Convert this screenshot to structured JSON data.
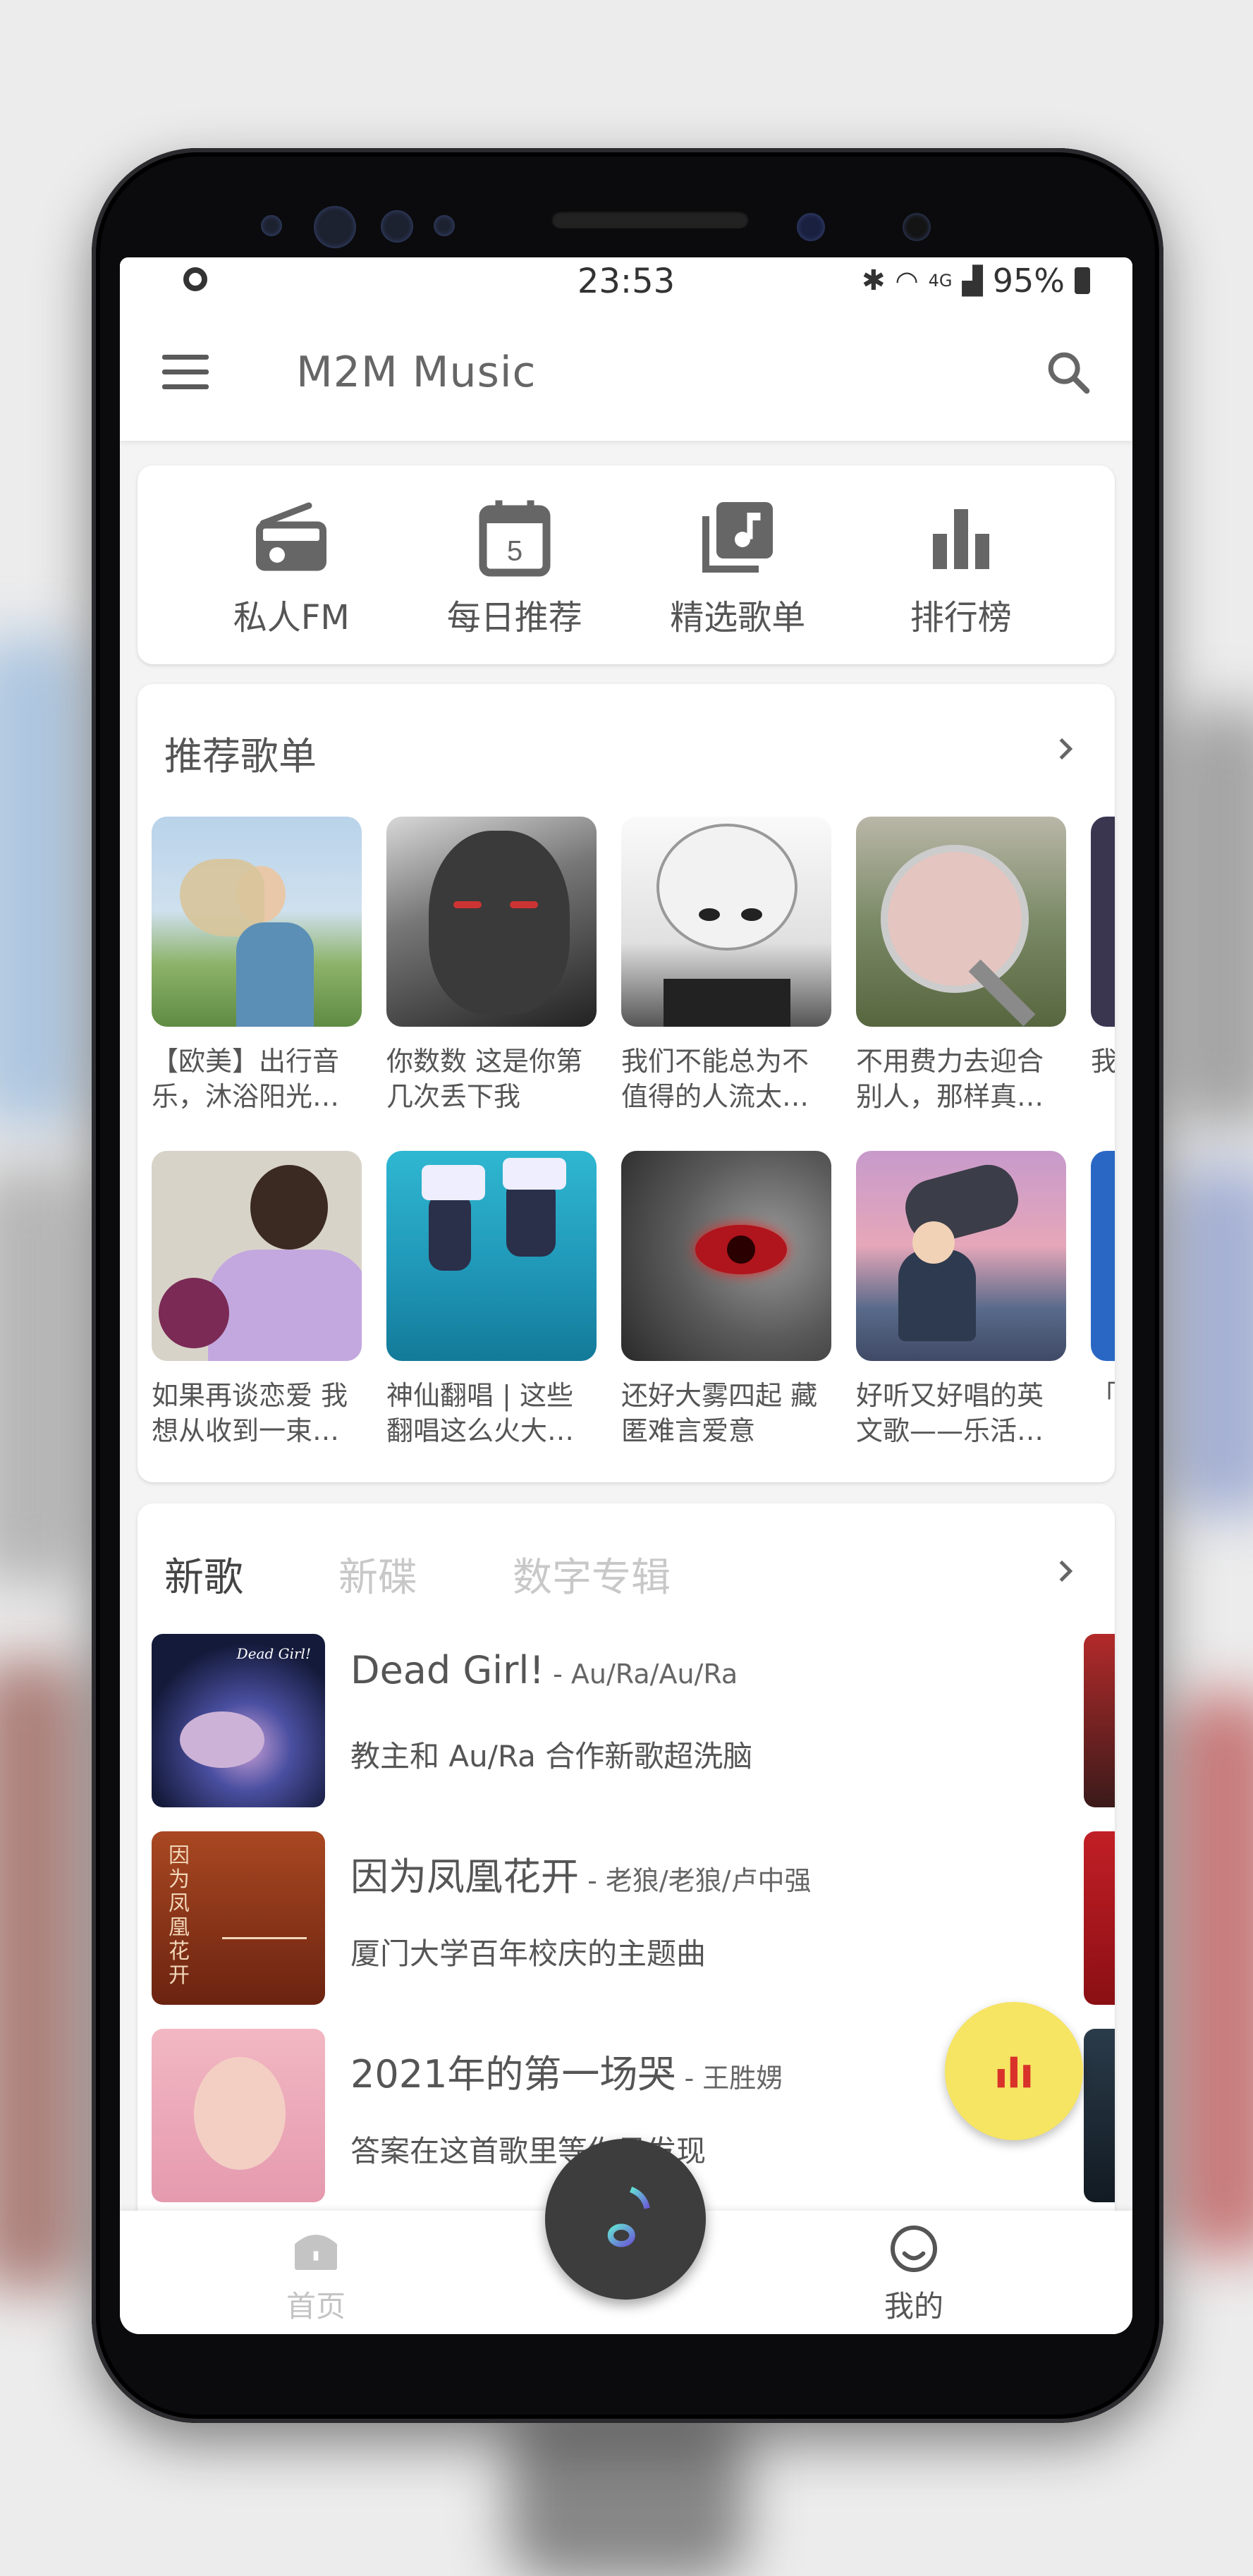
{
  "status_bar": {
    "time": "23:53",
    "signal_label": "4G",
    "battery": "95%"
  },
  "app_bar": {
    "title": "M2M Music"
  },
  "shortcuts": [
    {
      "label": "私人FM",
      "icon": "radio-icon"
    },
    {
      "label": "每日推荐",
      "icon": "calendar-icon",
      "day": "5"
    },
    {
      "label": "精选歌单",
      "icon": "music-library-icon"
    },
    {
      "label": "排行榜",
      "icon": "bar-chart-icon"
    }
  ],
  "recommended": {
    "title": "推荐歌单",
    "row1": [
      {
        "caption": "【欧美】出行音乐，沐浴阳光…"
      },
      {
        "caption": "你数数 这是你第几次丢下我"
      },
      {
        "caption": "我们不能总为不值得的人流太…"
      },
      {
        "caption": "不用费力去迎合别人，那样真…"
      },
      {
        "caption": "我也"
      }
    ],
    "row2": [
      {
        "caption": "如果再谈恋爱 我想从收到一束…"
      },
      {
        "caption": "神仙翻唱 | 这些翻唱这么火大…"
      },
      {
        "caption": "还好大雾四起 藏匿难言爱意"
      },
      {
        "caption": "好听又好唱的英文歌——乐活…"
      },
      {
        "caption": "「创"
      }
    ]
  },
  "new_music": {
    "tabs": [
      "新歌",
      "新碟",
      "数字专辑"
    ],
    "songs": [
      {
        "title": "Dead Girl!",
        "artist": " - Au/Ra/Au/Ra",
        "desc": "教主和 Au/Ra 合作新歌超洗脑",
        "art_text": "Dead Girl!"
      },
      {
        "title": "因为凤凰花开",
        "artist": " - 老狼/老狼/卢中强",
        "desc": "厦门大学百年校庆的主题曲",
        "art_text": "因为凤凰花开"
      },
      {
        "title": "2021年的第一场哭",
        "artist": " - 王胜娚",
        "desc": "答案在这首歌里等你寻发现"
      }
    ]
  },
  "bottom_nav": {
    "home": "首页",
    "mine": "我的"
  },
  "colors": {
    "accent": "#f6e463",
    "fab_dark": "#3d3d3d",
    "chart_red": "#d8322a",
    "tab_active": "#444444",
    "tab_inactive": "#c8c8c8"
  }
}
